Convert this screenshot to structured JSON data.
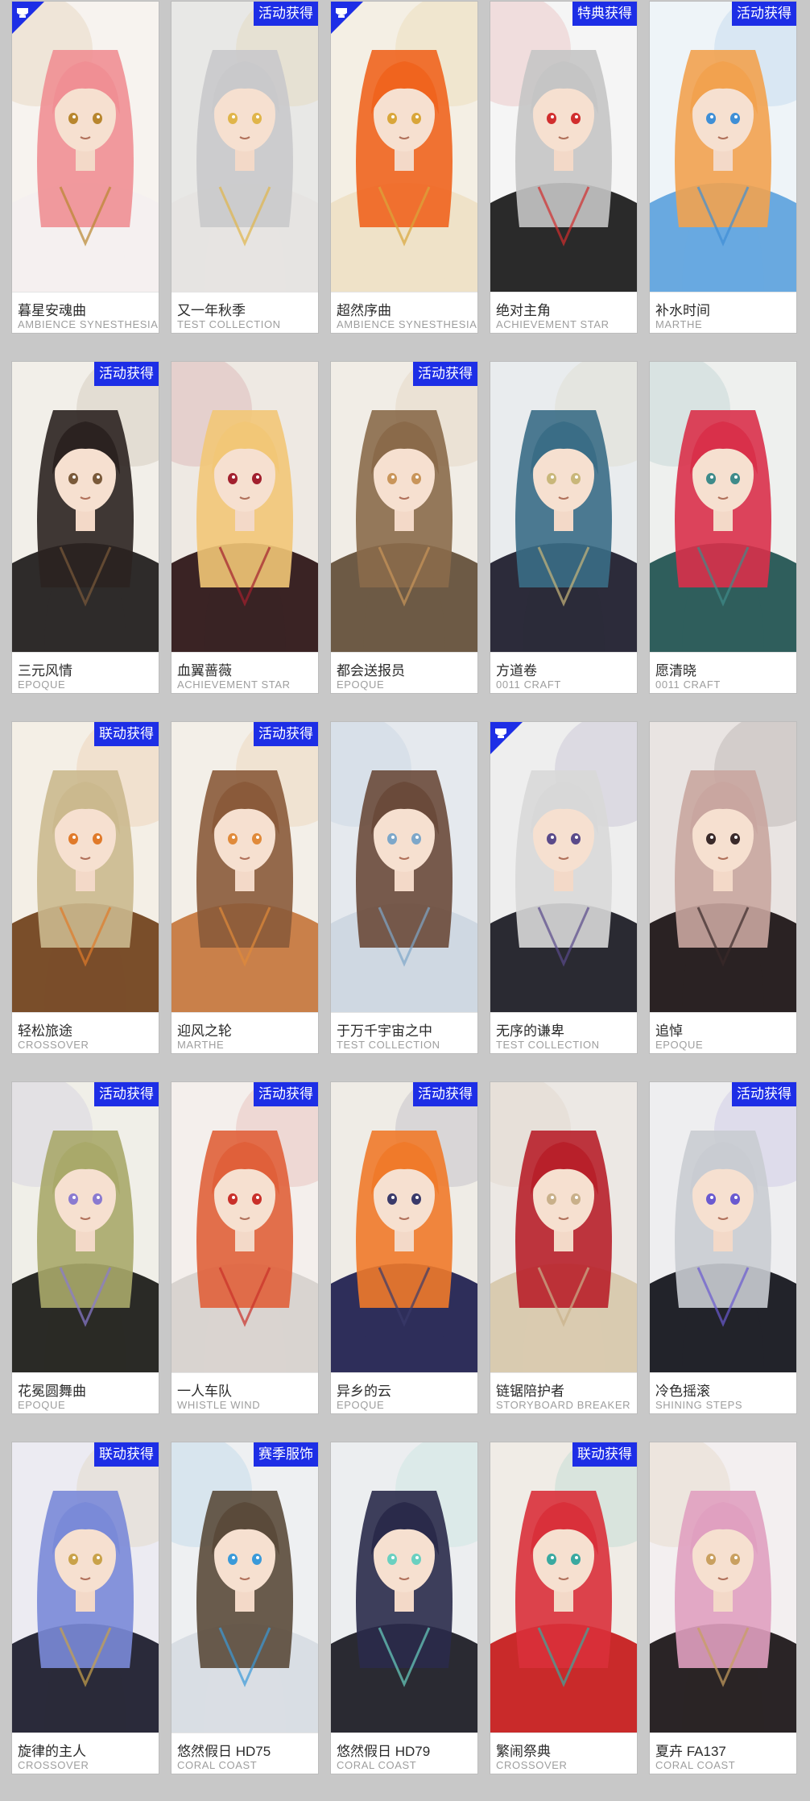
{
  "colors": {
    "tag_background": "#1d2ee6",
    "corner_badge": "#1d2ee6",
    "page_background": "#c8c8c8",
    "card_background": "#ffffff",
    "name_text": "#2b2b2b",
    "brand_text": "#9e9e9e"
  },
  "cards": [
    {
      "name": "暮星安魂曲",
      "brand": "AMBIENCE SYNESTHESIA",
      "tag": "",
      "corner_badge": true,
      "art": {
        "hair": "#f08f94",
        "accent": "#b8862e",
        "bg": "#f7f3ef",
        "outfit": "#f5f0f0"
      }
    },
    {
      "name": "又一年秋季",
      "brand": "TEST COLLECTION",
      "tag": "活动获得",
      "corner_badge": false,
      "art": {
        "hair": "#c9c9cb",
        "accent": "#e0b54a",
        "bg": "#e8e8e6",
        "outfit": "#e6e4e2"
      }
    },
    {
      "name": "超然序曲",
      "brand": "AMBIENCE SYNESTHESIA",
      "tag": "",
      "corner_badge": true,
      "art": {
        "hair": "#f0641e",
        "accent": "#d9a63a",
        "bg": "#f4efe4",
        "outfit": "#efe2c8"
      }
    },
    {
      "name": "绝对主角",
      "brand": "ACHIEVEMENT STAR",
      "tag": "特典获得",
      "corner_badge": false,
      "art": {
        "hair": "#c5c5c5",
        "accent": "#d12e2e",
        "bg": "#f5f5f5",
        "outfit": "#2a2a2a"
      }
    },
    {
      "name": "补水时间",
      "brand": "MARTHE",
      "tag": "活动获得",
      "corner_badge": false,
      "art": {
        "hair": "#f2a24f",
        "accent": "#3f8fd6",
        "bg": "#eef4f8",
        "outfit": "#69a9e0"
      }
    },
    {
      "name": "三元风情",
      "brand": "EPOQUE",
      "tag": "活动获得",
      "corner_badge": false,
      "art": {
        "hair": "#2b2220",
        "accent": "#7a5a3a",
        "bg": "#f2efe9",
        "outfit": "#2e2b2a"
      }
    },
    {
      "name": "血翼蔷薇",
      "brand": "ACHIEVEMENT STAR",
      "tag": "",
      "corner_badge": false,
      "art": {
        "hair": "#f2c777",
        "accent": "#a2202e",
        "bg": "#eee9e3",
        "outfit": "#3a2324"
      }
    },
    {
      "name": "都会送报员",
      "brand": "EPOQUE",
      "tag": "活动获得",
      "corner_badge": false,
      "art": {
        "hair": "#8a6a4a",
        "accent": "#c9955a",
        "bg": "#f1ede6",
        "outfit": "#6d5a45"
      }
    },
    {
      "name": "方道卷",
      "brand": "0011 CRAFT",
      "tag": "",
      "corner_badge": false,
      "art": {
        "hair": "#3a6d86",
        "accent": "#c9b77a",
        "bg": "#e9ecee",
        "outfit": "#2c2b3a"
      }
    },
    {
      "name": "愿清晓",
      "brand": "0011 CRAFT",
      "tag": "",
      "corner_badge": false,
      "art": {
        "hair": "#d9304a",
        "accent": "#3f8b8a",
        "bg": "#eef0ee",
        "outfit": "#2f5e5c"
      }
    },
    {
      "name": "轻松旅途",
      "brand": "CROSSOVER",
      "tag": "联动获得",
      "corner_badge": false,
      "art": {
        "hair": "#cbb98e",
        "accent": "#e07a2a",
        "bg": "#f4efe6",
        "outfit": "#7a4e2a"
      }
    },
    {
      "name": "迎风之轮",
      "brand": "MARTHE",
      "tag": "活动获得",
      "corner_badge": false,
      "art": {
        "hair": "#8a5a3a",
        "accent": "#e08a3a",
        "bg": "#f3efe8",
        "outfit": "#c9804a"
      }
    },
    {
      "name": "于万千宇宙之中",
      "brand": "TEST COLLECTION",
      "tag": "",
      "corner_badge": false,
      "art": {
        "hair": "#6a4a3a",
        "accent": "#7da7c9",
        "bg": "#e5e9ee",
        "outfit": "#cfd8e2"
      }
    },
    {
      "name": "无序的谦卑",
      "brand": "TEST COLLECTION",
      "tag": "",
      "corner_badge": true,
      "art": {
        "hair": "#d8d8d8",
        "accent": "#5a4a8a",
        "bg": "#eeeeee",
        "outfit": "#2a2a32"
      }
    },
    {
      "name": "追悼",
      "brand": "EPOQUE",
      "tag": "",
      "corner_badge": false,
      "art": {
        "hair": "#c9a6a0",
        "accent": "#3a2a2a",
        "bg": "#e9e4e2",
        "outfit": "#2a2223"
      }
    },
    {
      "name": "花冕圆舞曲",
      "brand": "EPOQUE",
      "tag": "活动获得",
      "corner_badge": false,
      "art": {
        "hair": "#a9a96a",
        "accent": "#8a7ad0",
        "bg": "#f0efe8",
        "outfit": "#2a2a26"
      }
    },
    {
      "name": "一人车队",
      "brand": "WHISTLE WIND",
      "tag": "活动获得",
      "corner_badge": false,
      "art": {
        "hair": "#e0603a",
        "accent": "#c9302a",
        "bg": "#f4efec",
        "outfit": "#d9d4d0"
      }
    },
    {
      "name": "异乡的云",
      "brand": "EPOQUE",
      "tag": "活动获得",
      "corner_badge": false,
      "art": {
        "hair": "#f07a2a",
        "accent": "#3a3a6a",
        "bg": "#efece6",
        "outfit": "#2e2e5a"
      }
    },
    {
      "name": "链锯陪护者",
      "brand": "STORYBOARD BREAKER",
      "tag": "",
      "corner_badge": false,
      "art": {
        "hair": "#b8202a",
        "accent": "#c9b08a",
        "bg": "#ece8e4",
        "outfit": "#d9cbb0"
      }
    },
    {
      "name": "冷色摇滚",
      "brand": "SHINING STEPS",
      "tag": "活动获得",
      "corner_badge": false,
      "art": {
        "hair": "#c9ccd2",
        "accent": "#6a5ad0",
        "bg": "#eeeef0",
        "outfit": "#22232a"
      }
    },
    {
      "name": "旋律的主人",
      "brand": "CROSSOVER",
      "tag": "联动获得",
      "corner_badge": false,
      "art": {
        "hair": "#7a8ad8",
        "accent": "#c9a24a",
        "bg": "#ecebf2",
        "outfit": "#2a2a3a"
      }
    },
    {
      "name": "悠然假日 HD75",
      "brand": "CORAL COAST",
      "tag": "赛季服饰",
      "corner_badge": false,
      "art": {
        "hair": "#5a4a3a",
        "accent": "#3a9ad9",
        "bg": "#eef0f2",
        "outfit": "#d9dee4"
      }
    },
    {
      "name": "悠然假日 HD79",
      "brand": "CORAL COAST",
      "tag": "",
      "corner_badge": false,
      "art": {
        "hair": "#2a2a4a",
        "accent": "#6ad0c0",
        "bg": "#eceef0",
        "outfit": "#2a2a32"
      }
    },
    {
      "name": "繁闹祭典",
      "brand": "CROSSOVER",
      "tag": "联动获得",
      "corner_badge": false,
      "art": {
        "hair": "#d9303a",
        "accent": "#3aa9a0",
        "bg": "#f0ece6",
        "outfit": "#c92a2a"
      }
    },
    {
      "name": "夏卉 FA137",
      "brand": "CORAL COAST",
      "tag": "",
      "corner_badge": false,
      "art": {
        "hair": "#e0a0c0",
        "accent": "#c9a060",
        "bg": "#f3eff0",
        "outfit": "#2a2426"
      }
    }
  ]
}
